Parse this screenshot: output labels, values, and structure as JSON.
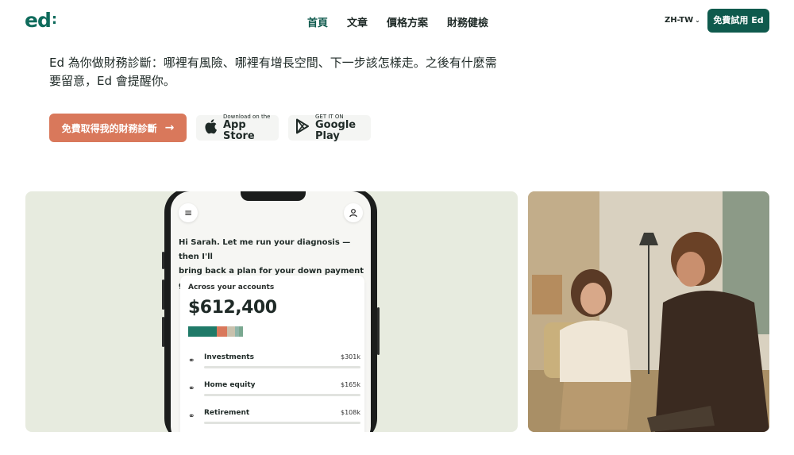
{
  "header": {
    "logo": "ed",
    "logo_dots": ":",
    "nav": [
      "首頁",
      "文章",
      "價格方案",
      "財務健檢"
    ],
    "lang": "ZH-TW",
    "cta": "免費試用 Ed"
  },
  "hero": {
    "description_line1": "Ed 為你做財務診斷：哪裡有風險、哪裡有增長空間、下一步該怎樣走。之後有什麼需",
    "description_line2": "要留意，Ed 會提醒你。",
    "primary_button": "免費取得我的財務診斷",
    "app_store_small": "Download on the",
    "app_store_big": "App Store",
    "google_play_small": "GET IT ON",
    "google_play_big": "Google Play"
  },
  "phone": {
    "greeting_line1": "Hi Sarah. Let me run your diagnosis — then I'll",
    "greeting_line2": "bring back a plan for your down payment goal.",
    "card_label": "Across your accounts",
    "total": "$612,400",
    "bar_colors": [
      "#1f7a68",
      "#d9785b",
      "#c9c1ad",
      "#8fb5a9",
      "#7aa890"
    ],
    "accounts": [
      {
        "name": "Investments",
        "amount": "$301k"
      },
      {
        "name": "Home equity",
        "amount": "$165k"
      },
      {
        "name": "Retirement",
        "amount": "$108k"
      }
    ]
  },
  "colors": {
    "brand": "#0f5a4d",
    "accent": "#d9785b",
    "panel": "#e7ebdf"
  }
}
